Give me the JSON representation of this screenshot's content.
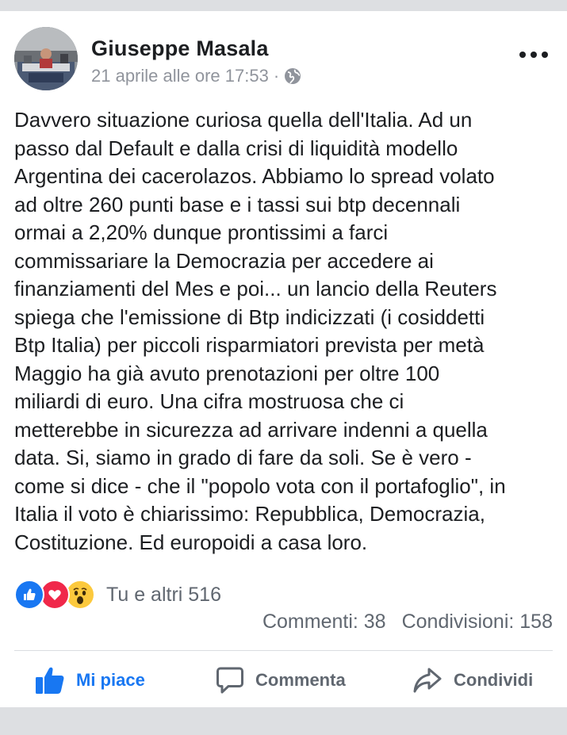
{
  "post": {
    "author": "Giuseppe Masala",
    "timestamp": "21 aprile alle ore 17:53",
    "separator": "·",
    "privacy_icon": "globe-icon",
    "avatar_icon": "profile-photo",
    "more_icon": "more-options-icon",
    "text": "Davvero situazione curiosa quella dell'Italia. Ad un\npasso dal Default e dalla crisi di liquidità modello\nArgentina dei cacerolazos. Abbiamo lo spread volato\nad oltre 260 punti base e i tassi sui btp decennali\normai a 2,20% dunque prontissimi a farci\ncommissariare la Democrazia per accedere ai\nfinanziamenti del Mes e poi... un lancio della Reuters\nspiega che l'emissione di Btp indicizzati (i cosiddetti\nBtp Italia) per piccoli risparmiatori prevista per metà\nMaggio ha già avuto prenotazioni per oltre 100\nmiliardi di euro. Una cifra mostruosa che ci\nmetterebbe in sicurezza ad arrivare indenni a quella\ndata. Si, siamo in grado di fare da soli. Se è vero -\ncome si dice - che il \"popolo vota con il portafoglio\", in\nItalia il voto è chiarissimo: Repubblica, Democrazia,\nCostituzione. Ed europoidi a casa loro."
  },
  "reactions": {
    "icons": [
      "like-reaction-icon",
      "love-reaction-icon",
      "wow-reaction-icon"
    ],
    "summary": "Tu e altri 516"
  },
  "stats": {
    "comments": "Commenti: 38",
    "shares": "Condivisioni: 158"
  },
  "actions": {
    "like": "Mi piace",
    "comment": "Commenta",
    "share": "Condividi"
  },
  "colors": {
    "accent": "#1877f2",
    "text": "#1c1e21",
    "secondary": "#606770",
    "love": "#f0284a",
    "wow": "#fcc93d"
  }
}
